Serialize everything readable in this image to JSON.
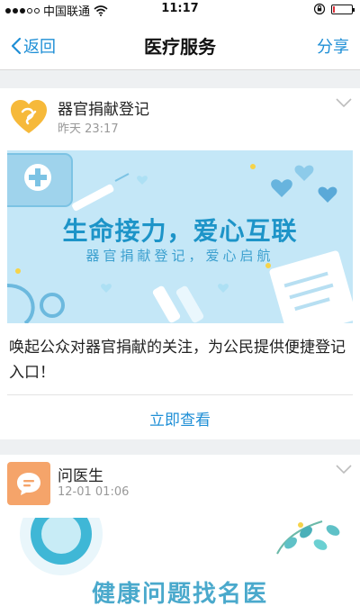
{
  "status_bar": {
    "carrier": "中国联通",
    "time": "11:17",
    "battery_level": 0.12,
    "battery_color": "#e0303a"
  },
  "nav": {
    "back_label": "返回",
    "title": "医疗服务",
    "share_label": "分享",
    "accent": "#1f8fd6"
  },
  "cards": [
    {
      "title": "器官捐献登记",
      "time": "昨天 23:17",
      "banner_title": "生命接力，爱心互联",
      "banner_subtitle": "器官捐献登记，爱心启航",
      "description": "唤起公众对器官捐献的关注，为公民提供便捷登记入口！",
      "action_label": "立即查看",
      "logo_icon": "heart-hands-icon",
      "logo_color": "#f6b93a"
    },
    {
      "title": "问医生",
      "time": "12-01 01:06",
      "banner_title": "健康问题找名医",
      "logo_icon": "chat-bubble-icon",
      "logo_color": "#f5a46a"
    }
  ]
}
